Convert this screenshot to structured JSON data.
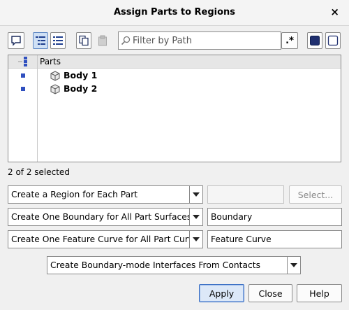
{
  "window": {
    "title": "Assign Parts to Regions",
    "close_glyph": "×"
  },
  "toolbar": {
    "filter_placeholder": "Filter by Path",
    "regex_label": ".*"
  },
  "tree": {
    "column_header": "Parts",
    "rows": [
      {
        "label": "Body 1",
        "icon": "part-icon"
      },
      {
        "label": "Body 2",
        "icon": "part-icon"
      }
    ]
  },
  "status": "2 of 2 selected",
  "options": {
    "region_mode": "Create a Region for Each Part",
    "region_select_label": "Select...",
    "boundary_mode": "Create One Boundary for All Part Surfaces",
    "boundary_name": "Boundary",
    "feature_mode": "Create One Feature Curve for All Part Curves",
    "feature_name": "Feature Curve",
    "interface_mode": "Create Boundary-mode Interfaces From Contacts"
  },
  "buttons": {
    "apply": "Apply",
    "close": "Close",
    "help": "Help"
  }
}
